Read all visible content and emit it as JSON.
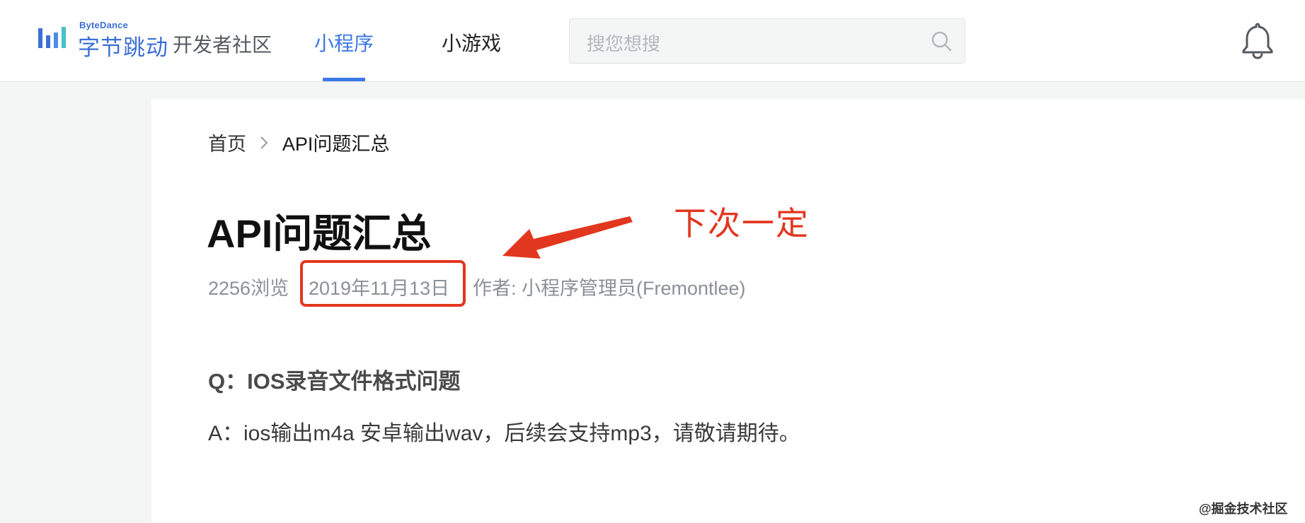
{
  "header": {
    "logo_en": "ByteDance",
    "logo_cn": "字节跳动",
    "logo_sub": "开发者社区",
    "tabs": [
      {
        "label": "小程序",
        "active": true
      },
      {
        "label": "小游戏",
        "active": false
      }
    ],
    "search": {
      "placeholder": "搜您想搜"
    }
  },
  "breadcrumb": {
    "home": "首页",
    "current": "API问题汇总"
  },
  "article": {
    "title": "API问题汇总",
    "views": "2256浏览",
    "date": "2019年11月13日",
    "author": "作者: 小程序管理员(Fremontlee)",
    "question": "Q：IOS录音文件格式问题",
    "answer": "A：ios输出m4a 安卓输出wav，后续会支持mp3，请敬请期待。"
  },
  "annotation": {
    "text": "下次一定",
    "color": "#e2371f"
  },
  "watermark": "@掘金技术社区",
  "colors": {
    "brand": "#3c6fd6",
    "active_tab": "#3c78e6",
    "background": "#f4f5f5"
  },
  "icons": {
    "logo": "bar-chart-logo-icon",
    "search": "search-icon",
    "bell": "bell-icon",
    "breadcrumb_separator": "chevron-right-icon"
  }
}
